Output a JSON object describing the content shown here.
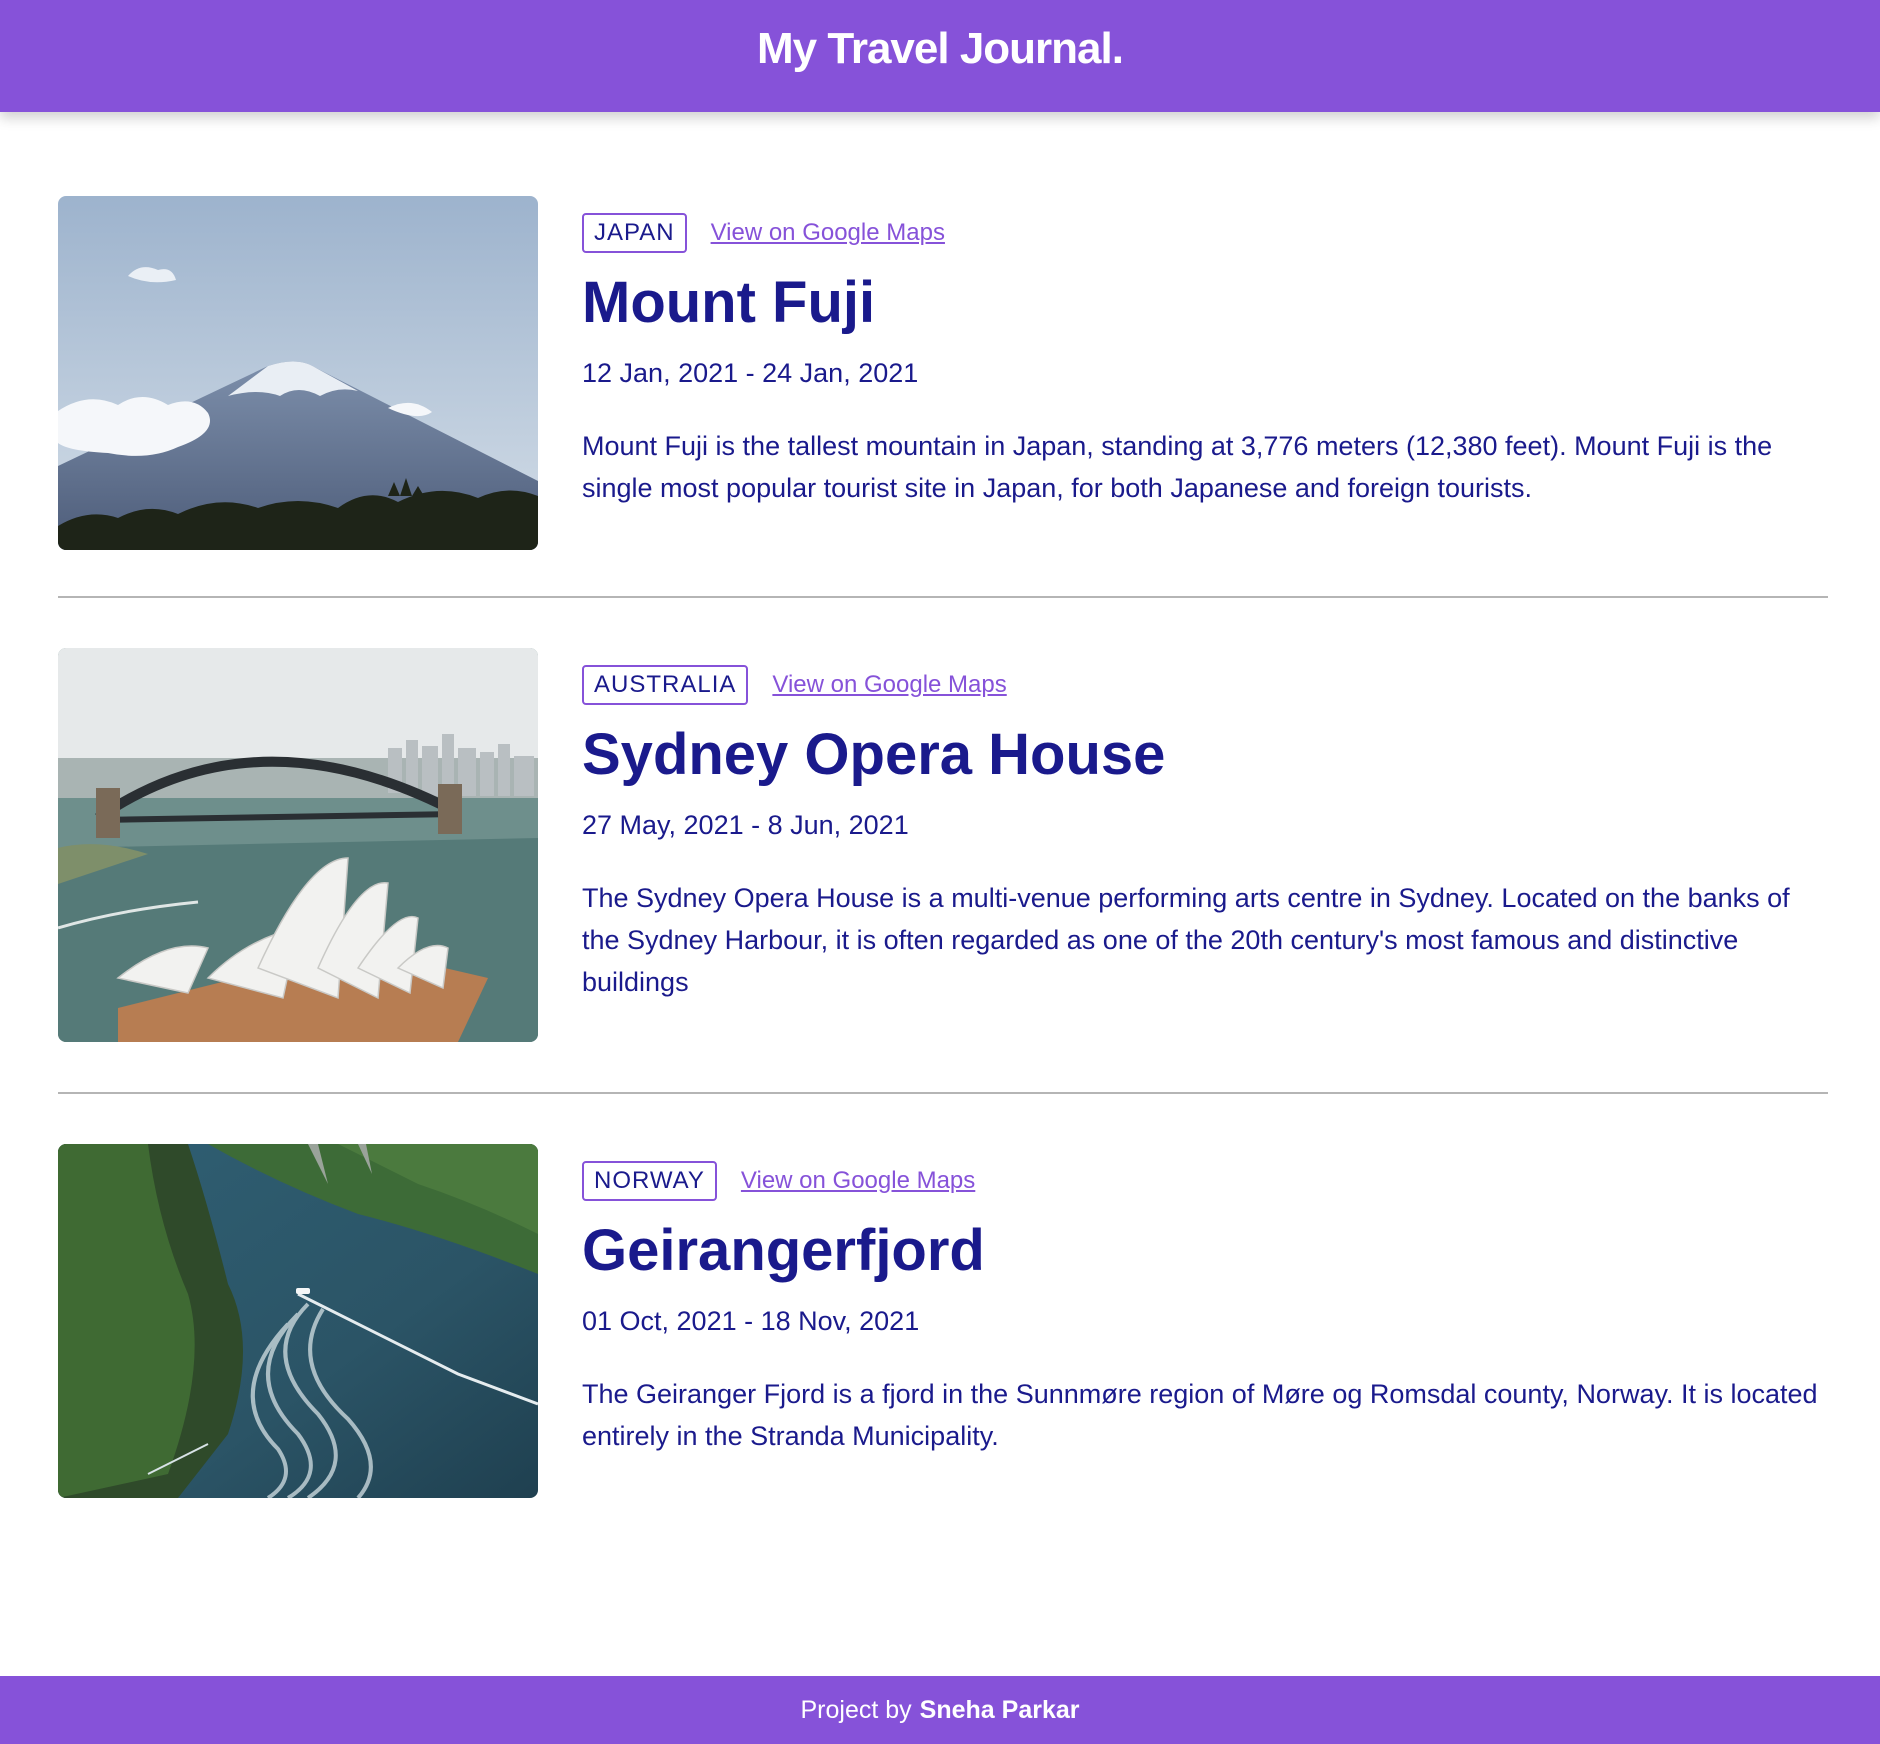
{
  "header": {
    "title": "My Travel Journal."
  },
  "entries": [
    {
      "country": "JAPAN",
      "maps_link_label": "View on Google Maps",
      "title": "Mount Fuji",
      "dates": "12 Jan, 2021 - 24 Jan, 2021",
      "description": "Mount Fuji is the tallest mountain in Japan, standing at 3,776 meters (12,380 feet). Mount Fuji is the single most popular tourist site in Japan, for both Japanese and foreign tourists."
    },
    {
      "country": "AUSTRALIA",
      "maps_link_label": "View on Google Maps",
      "title": "Sydney Opera House",
      "dates": "27 May, 2021 - 8 Jun, 2021",
      "description": "The Sydney Opera House is a multi-venue performing arts centre in Sydney. Located on the banks of the Sydney Harbour, it is often regarded as one of the 20th century's most famous and distinctive buildings"
    },
    {
      "country": "NORWAY",
      "maps_link_label": "View on Google Maps",
      "title": "Geirangerfjord",
      "dates": "01 Oct, 2021 - 18 Nov, 2021",
      "description": "The Geiranger Fjord is a fjord in the Sunnmøre region of Møre og Romsdal county, Norway. It is located entirely in the Stranda Municipality."
    }
  ],
  "footer": {
    "prefix": "Project by",
    "author": "Sneha Parkar"
  },
  "colors": {
    "brand": "#8652d9",
    "text": "#1a1a8c",
    "divider": "#b5b5b5"
  }
}
